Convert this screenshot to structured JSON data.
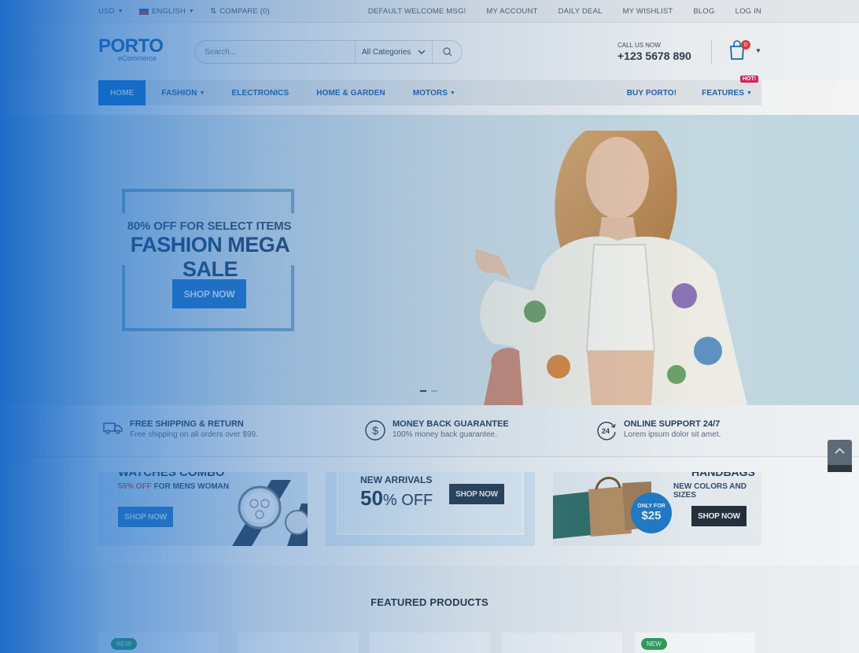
{
  "topbar": {
    "currency": "USD",
    "language": "ENGLISH",
    "compare": "COMPARE (0)",
    "links": [
      "DEFAULT WELCOME MSG!",
      "MY ACCOUNT",
      "DAILY DEAL",
      "MY WISHLIST",
      "BLOG",
      "LOG IN"
    ]
  },
  "header": {
    "logo_main": "PORTO",
    "logo_sub": "eCommerce",
    "search_placeholder": "Search...",
    "category": "All Categories",
    "call_label": "CALL US NOW",
    "phone": "+123 5678 890",
    "cart_count": "0"
  },
  "nav": {
    "home": "HOME",
    "fashion": "FASHION",
    "electronics": "ELECTRONICS",
    "home_garden": "HOME & GARDEN",
    "motors": "MOTORS",
    "buy": "BUY PORTO!",
    "features": "FEATURES",
    "hot": "HOT!"
  },
  "hero": {
    "subtitle": "80% OFF FOR SELECT ITEMS",
    "title": "FASHION MEGA SALE",
    "button": "SHOP NOW"
  },
  "features": [
    {
      "title": "FREE SHIPPING & RETURN",
      "desc": "Free shipping on all orders over $99."
    },
    {
      "title": "MONEY BACK GUARANTEE",
      "desc": "100% money back guarantee."
    },
    {
      "title": "ONLINE SUPPORT 24/7",
      "desc": "Lorem ipsum dolor sit amet."
    }
  ],
  "banners": {
    "b1": {
      "title": "WATCHES COMBO",
      "pct": "55%",
      "off": "OFF",
      "rest": "FOR MENS WOMAN",
      "button": "SHOP NOW"
    },
    "b2": {
      "title": "NEW ARRIVALS",
      "big": "50",
      "pct_off": "% OFF",
      "button": "SHOP NOW"
    },
    "b3": {
      "title": "HANDBAGS",
      "sub": "NEW COLORS AND SIZES",
      "only": "ONLY FOR",
      "price": "$25",
      "button": "SHOP NOW"
    }
  },
  "featured": {
    "title": "FEATURED PRODUCTS",
    "badge1": "NEW",
    "badge2": "NEW"
  },
  "colors": {
    "accent": "#0f6fc6",
    "hot": "#d61f54",
    "new_badge": "#2a9a56",
    "cart_badge": "#d63a3a"
  }
}
